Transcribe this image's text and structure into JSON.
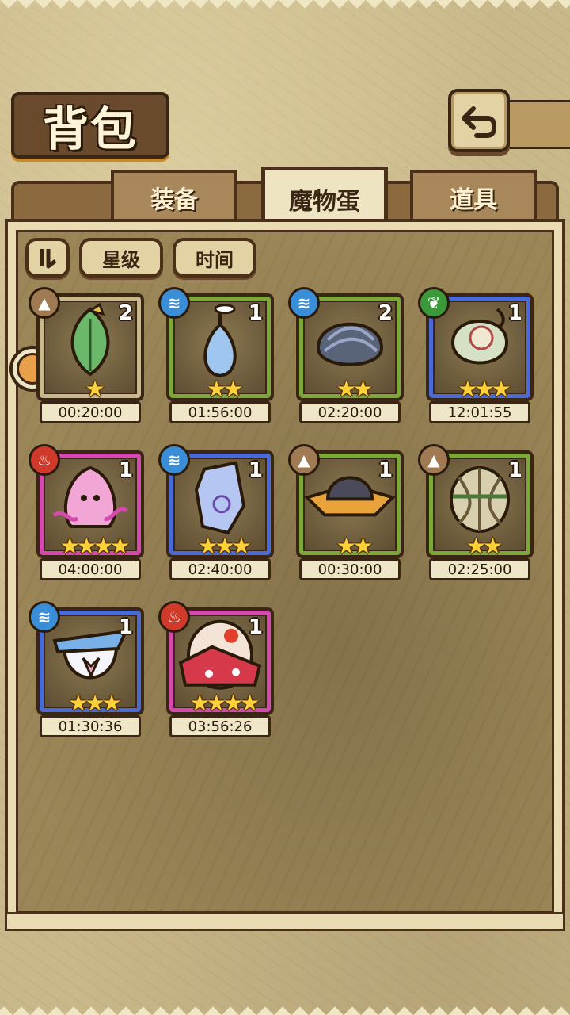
{
  "header": {
    "title": "背包",
    "back_icon": "back-arrow-icon"
  },
  "tabs": [
    {
      "label": "装备",
      "active": false
    },
    {
      "label": "魔物蛋",
      "active": true
    },
    {
      "label": "道具",
      "active": false
    }
  ],
  "sort": {
    "toggle_icon": "sort-toggle-icon",
    "by_star_label": "星级",
    "by_time_label": "时间"
  },
  "colors": {
    "frame_brown": "#c9b88a",
    "frame_green": "#7ca83a",
    "frame_blue": "#4a6ad8",
    "frame_pink": "#d64ab0"
  },
  "eggs": [
    {
      "element": "earth",
      "count": "2",
      "stars": "★",
      "timer": "00:20:00",
      "frame": "brown",
      "egg": "leaf"
    },
    {
      "element": "water",
      "count": "1",
      "stars": "★★",
      "timer": "01:56:00",
      "frame": "green",
      "egg": "drop"
    },
    {
      "element": "water",
      "count": "2",
      "stars": "★★",
      "timer": "02:20:00",
      "frame": "green",
      "egg": "shell"
    },
    {
      "element": "nature",
      "count": "1",
      "stars": "★★★",
      "timer": "12:01:55",
      "frame": "blue",
      "egg": "melon"
    },
    {
      "element": "fire",
      "count": "1",
      "stars": "★★★★",
      "timer": "04:00:00",
      "frame": "pink",
      "egg": "ghost"
    },
    {
      "element": "water",
      "count": "1",
      "stars": "★★★",
      "timer": "02:40:00",
      "frame": "blue",
      "egg": "crystal"
    },
    {
      "element": "earth",
      "count": "1",
      "stars": "★★",
      "timer": "00:30:00",
      "frame": "green",
      "egg": "rock"
    },
    {
      "element": "earth",
      "count": "1",
      "stars": "★★",
      "timer": "02:25:00",
      "frame": "green",
      "egg": "cage"
    },
    {
      "element": "water",
      "count": "1",
      "stars": "★★★",
      "timer": "01:30:36",
      "frame": "blue",
      "egg": "sailor"
    },
    {
      "element": "fire",
      "count": "1",
      "stars": "★★★★",
      "timer": "03:56:26",
      "frame": "pink",
      "egg": "kimono"
    }
  ]
}
